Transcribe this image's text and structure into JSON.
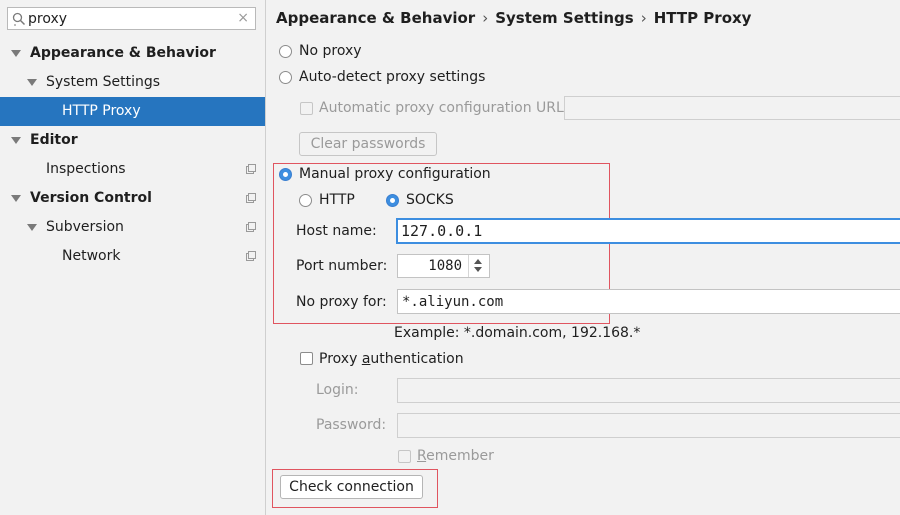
{
  "search": {
    "value": "proxy",
    "clear_glyph": "×"
  },
  "tree": {
    "items": [
      {
        "label": "Appearance & Behavior",
        "expanded": true
      },
      {
        "label": "System Settings",
        "expanded": true
      },
      {
        "label": "HTTP Proxy",
        "selected": true
      },
      {
        "label": "Editor",
        "expanded": true
      },
      {
        "label": "Inspections",
        "project_icon": "project-scope-icon"
      },
      {
        "label": "Version Control",
        "expanded": true,
        "project_icon": "project-scope-icon"
      },
      {
        "label": "Subversion",
        "expanded": true,
        "project_icon": "project-scope-icon"
      },
      {
        "label": "Network",
        "project_icon": "project-scope-icon"
      }
    ]
  },
  "breadcrumb": {
    "items": [
      "Appearance & Behavior",
      "System Settings",
      "HTTP Proxy"
    ],
    "separator": "›"
  },
  "proxy": {
    "no_proxy_label": "No proxy",
    "auto_detect_label": "Auto-detect proxy settings",
    "auto_config_url_label": "Automatic proxy configuration URL:",
    "auto_config_url_value": "",
    "clear_passwords_label": "Clear passwords",
    "manual_label": "Manual proxy configuration",
    "selected_mode": "manual",
    "http_label": "HTTP",
    "socks_label": "SOCKS",
    "selected_type": "SOCKS",
    "host_label": "Host name:",
    "host_value": "127.0.0.1",
    "port_label": "Port number:",
    "port_value": "1080",
    "no_proxy_for_label": "No proxy for:",
    "no_proxy_for_value": "*.aliyun.com",
    "example_text": "Example: *.domain.com, 192.168.*",
    "auth": {
      "label_pre": "Proxy ",
      "label_mnemonic": "a",
      "label_post": "uthentication",
      "checked": false,
      "login_label": "Login:",
      "login_value": "",
      "password_label": "Password:",
      "password_value": "",
      "remember_mnemonic": "R",
      "remember_rest": "emember"
    },
    "check_connection_label": "Check connection"
  },
  "colors": {
    "selection": "#2675bf",
    "highlight_box": "#e05560",
    "radio_selected": "#3d8ee0"
  }
}
